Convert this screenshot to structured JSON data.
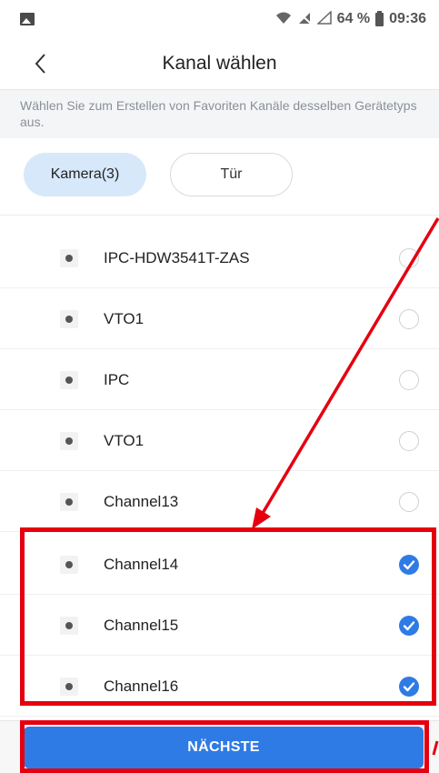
{
  "status_bar": {
    "battery_percent": "64 %",
    "time": "09:36",
    "icons": [
      "image-icon",
      "wifi-question-icon",
      "no-sim-icon",
      "signal-icon",
      "battery-icon"
    ]
  },
  "header": {
    "title": "Kanal wählen",
    "back_icon": "chevron-left-icon"
  },
  "hint": "Wählen Sie zum Erstellen von Favoriten Kanäle desselben Gerätetyps aus.",
  "tabs": [
    {
      "label": "Kamera(3)",
      "selected": true
    },
    {
      "label": "Tür",
      "selected": false
    }
  ],
  "channels": [
    {
      "name": "IPC-HDW3541T-ZAS",
      "checked": false
    },
    {
      "name": "VTO1",
      "checked": false
    },
    {
      "name": "IPC",
      "checked": false
    },
    {
      "name": "VTO1",
      "checked": false
    },
    {
      "name": "Channel13",
      "checked": false
    },
    {
      "name": "Channel14",
      "checked": true
    },
    {
      "name": "Channel15",
      "checked": true
    },
    {
      "name": "Channel16",
      "checked": true
    }
  ],
  "footer": {
    "next_label": "NÄCHSTE"
  },
  "colors": {
    "accent": "#2f7be5",
    "tab_selected": "#d7e8fb",
    "annotation": "#e5000f"
  }
}
